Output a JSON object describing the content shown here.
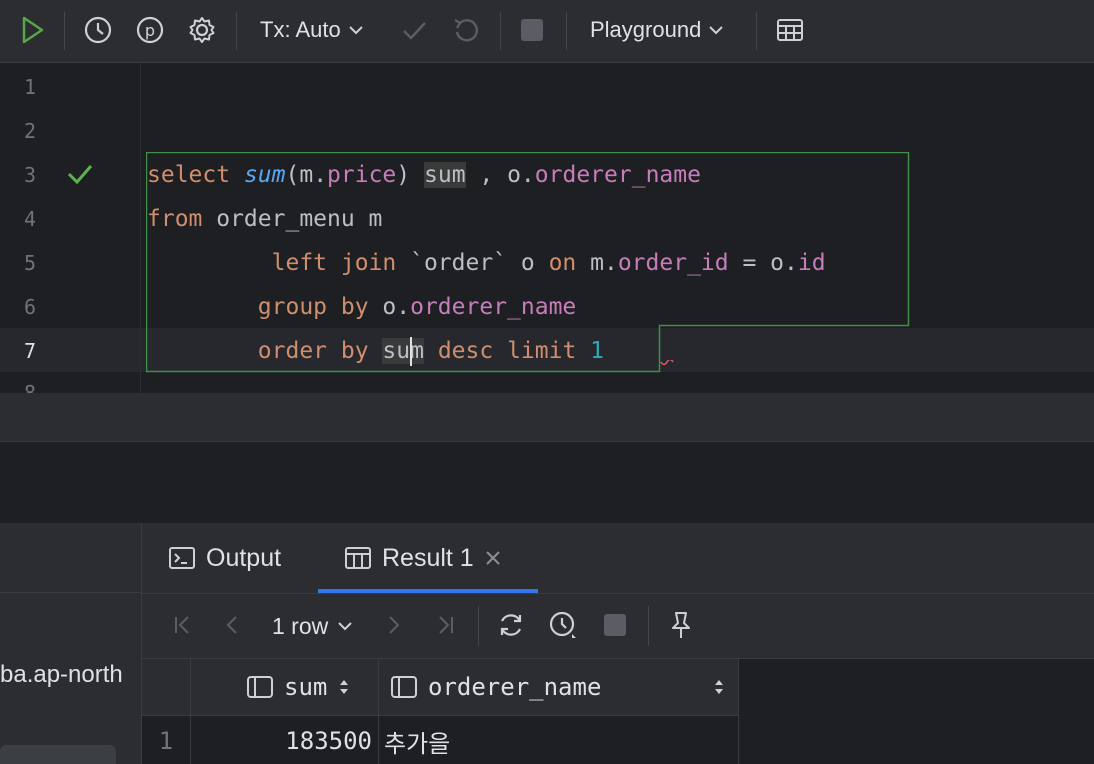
{
  "toolbar": {
    "tx_label": "Tx: Auto",
    "playground_label": "Playground"
  },
  "editor": {
    "line_numbers": [
      "1",
      "2",
      "3",
      "4",
      "5",
      "6",
      "7",
      "8"
    ]
  },
  "results": {
    "tabs": [
      {
        "label": "Output"
      },
      {
        "label": "Result 1"
      }
    ],
    "row_count": "1 row",
    "columns": [
      "sum",
      "orderer_name"
    ],
    "rows": [
      {
        "index": "1",
        "sum": "183500",
        "orderer_name": "추가을"
      }
    ]
  },
  "sidebar": {
    "host_text": "ba.ap-north"
  },
  "colors": {
    "keyword": "#cf8e6d",
    "function": "#56a8f5",
    "column": "#c77dbb",
    "number": "#2aacb8",
    "run_green": "#499c54"
  }
}
